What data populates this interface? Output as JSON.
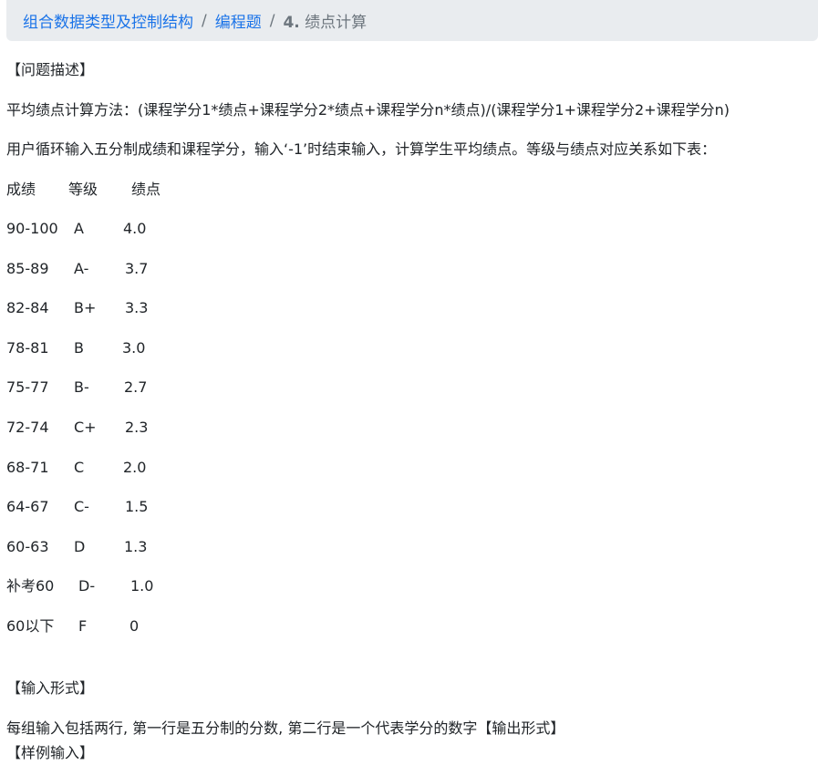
{
  "breadcrumb": {
    "items": [
      "组合数据类型及控制结构",
      "编程题"
    ],
    "separator": "/",
    "current_num": "4.",
    "current_title": "绩点计算"
  },
  "content": {
    "problem_header": "【问题描述】",
    "formula": "平均绩点计算方法：(课程学分1*绩点+课程学分2*绩点+课程学分n*绩点)/(课程学分1+课程学分2+课程学分n)",
    "instruction": "用户循环输入五分制成绩和课程学分，输入‘-1’时结束输入，计算学生平均绩点。等级与绩点对应关系如下表：",
    "table_headers": [
      "成绩",
      "等级",
      "绩点"
    ],
    "table_rows": [
      [
        "90-100",
        "A",
        "4.0"
      ],
      [
        "85-89",
        "A-",
        "3.7"
      ],
      [
        "82-84",
        "B+",
        "3.3"
      ],
      [
        "78-81",
        "B",
        "3.0"
      ],
      [
        "75-77",
        "B-",
        "2.7"
      ],
      [
        "72-74",
        "C+",
        "2.3"
      ],
      [
        "68-71",
        "C",
        "2.0"
      ],
      [
        "64-67",
        "C-",
        "1.5"
      ],
      [
        "60-63",
        "D",
        "1.3"
      ],
      [
        "补考60",
        "D-",
        "1.0"
      ],
      [
        "60以下",
        "F",
        "0"
      ]
    ],
    "input_header": "【输入形式】",
    "input_desc": "每组输入包括两行, 第一行是五分制的分数, 第二行是一个代表学分的数字【输出形式】",
    "sample_header": "【样例输入】"
  }
}
